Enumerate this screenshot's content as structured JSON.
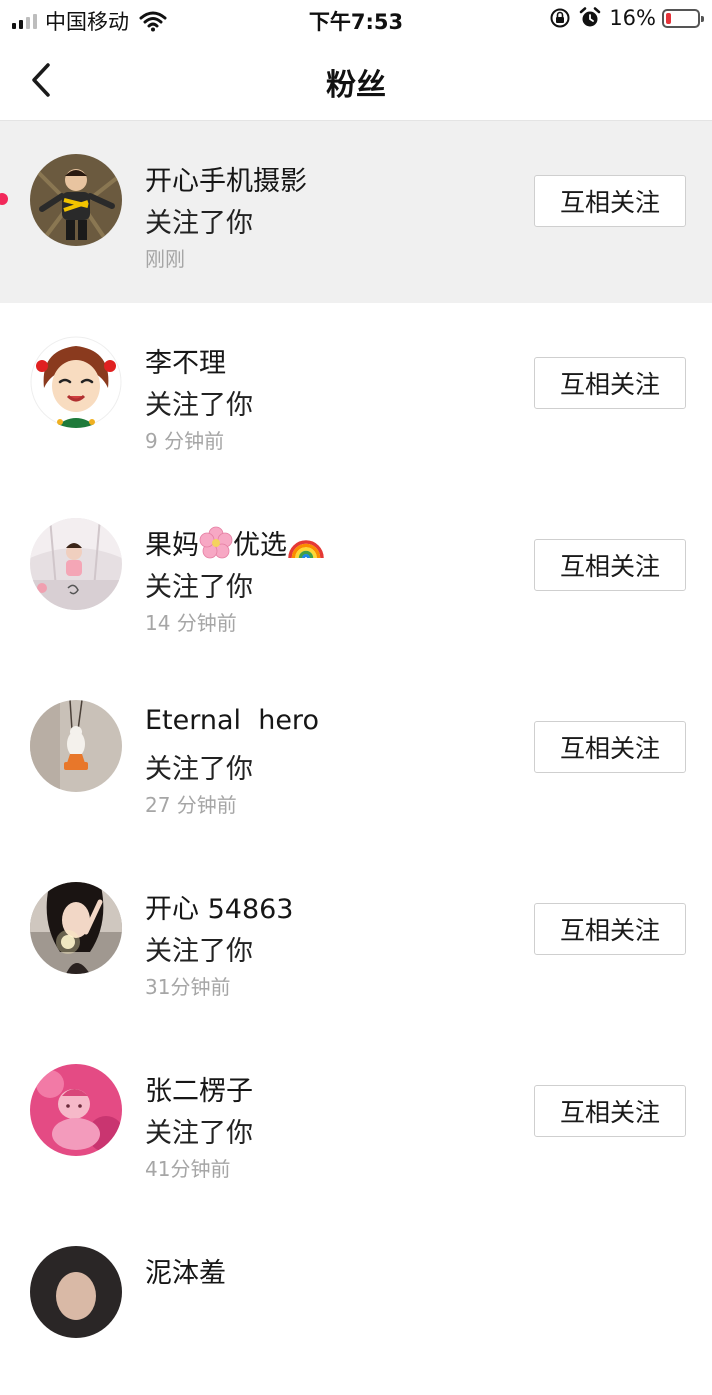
{
  "status_bar": {
    "carrier": "中国移动",
    "time": "下午7:53",
    "battery_percent": "16%",
    "battery_level": 0.16,
    "battery_color": "#e5333a"
  },
  "header": {
    "title": "粉丝",
    "back_icon": "chevron-left-icon"
  },
  "followers": [
    {
      "name": "开心手机摄影",
      "action": "关注了你",
      "time": "刚刚",
      "button": "互相关注",
      "unread": true
    },
    {
      "name": "李不理",
      "action": "关注了你",
      "time": "9 分钟前",
      "button": "互相关注"
    },
    {
      "name_parts": [
        "果妈",
        "优选"
      ],
      "emojis": [
        "cherry-blossom-emoji",
        "rainbow-emoji"
      ],
      "action": "关注了你",
      "time": "14 分钟前",
      "button": "互相关注"
    },
    {
      "name": "Eternal  hero",
      "action": "关注了你",
      "time": "27 分钟前",
      "button": "互相关注"
    },
    {
      "name": "开心 54863",
      "action": "关注了你",
      "time": "31分钟前",
      "button": "互相关注"
    },
    {
      "name": "张二楞子",
      "action": "关注了你",
      "time": "41分钟前",
      "button": "互相关注"
    },
    {
      "name": "泥泍羞"
    }
  ],
  "colors": {
    "highlight_row": "#f0f0f0",
    "unread_dot": "#f2285a",
    "secondary_text": "#a6a6a6"
  }
}
